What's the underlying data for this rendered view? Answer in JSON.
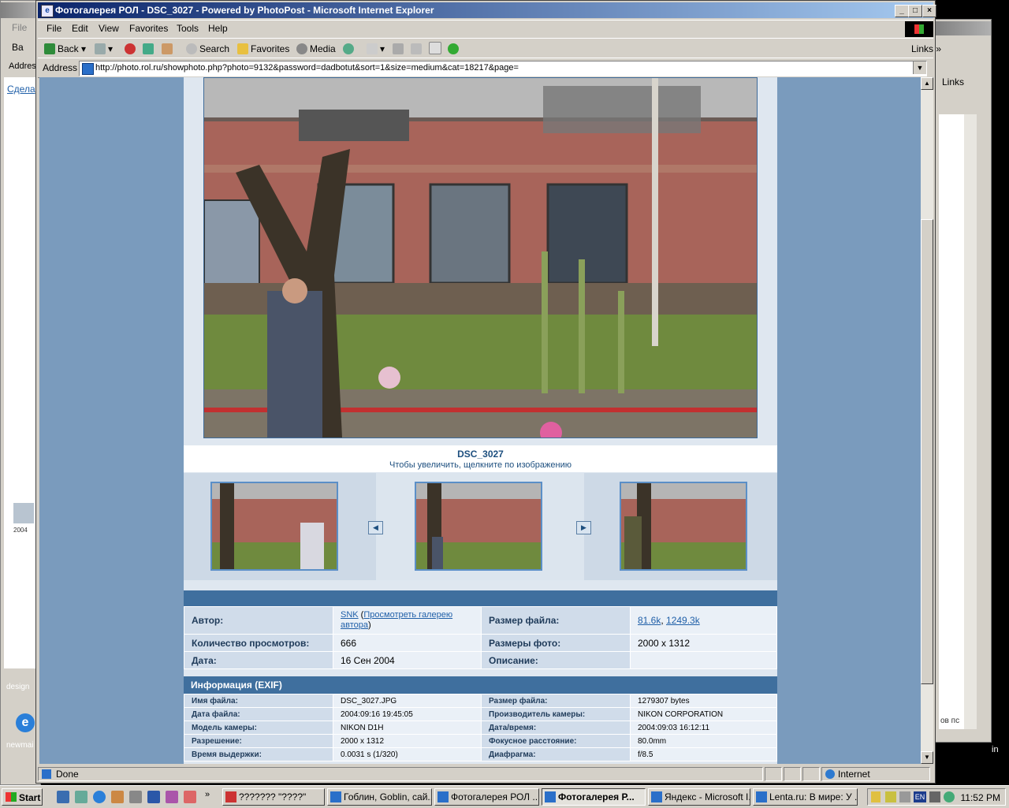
{
  "window": {
    "title": "Фотогалерея РОЛ - DSC_3027 - Powered by PhotoPost - Microsoft Internet Explorer"
  },
  "menu": [
    "File",
    "Edit",
    "View",
    "Favorites",
    "Tools",
    "Help"
  ],
  "toolbar": {
    "back": "Back",
    "search": "Search",
    "favorites": "Favorites",
    "media": "Media",
    "links": "Links"
  },
  "address": {
    "label": "Address",
    "url": "http://photo.rol.ru/showphoto.php?photo=9132&password=dadbotut&sort=1&size=medium&cat=18217&page="
  },
  "photo": {
    "title": "DSC_3027",
    "hint": "Чтобы увеличить, щелкните по изображению"
  },
  "details": {
    "author_label": "Автор:",
    "author_name": "SNK",
    "author_gallery_open": " (",
    "author_gallery": "Просмотреть галерею автора",
    "author_gallery_close": ")",
    "filesize_label": "Размер файла:",
    "filesize_small": "81.6k",
    "filesize_sep": ", ",
    "filesize_large": "1249.3k",
    "views_label": "Количество просмотров:",
    "views": "666",
    "dimensions_label": "Размеры фото:",
    "dimensions": "2000 x 1312",
    "date_label": "Дата:",
    "date": "16 Сен 2004",
    "description_label": "Описание:",
    "description": ""
  },
  "exif": {
    "header": "Информация (EXIF)",
    "rows": [
      [
        "Имя файла:",
        "DSC_3027.JPG",
        "Размер файла:",
        "1279307 bytes"
      ],
      [
        "Дата файла:",
        "2004:09:16 19:45:05",
        "Производитель камеры:",
        "NIKON CORPORATION"
      ],
      [
        "Модель камеры:",
        "NIKON D1H",
        "Дата/время:",
        "2004:09:03 16:12:11"
      ],
      [
        "Разрешение:",
        "2000 x 1312",
        "Фокусное расстояние:",
        "80.0mm"
      ],
      [
        "Время выдержки:",
        "0.0031 s (1/320)",
        "Диафрагма:",
        "f/8.5"
      ]
    ]
  },
  "status": {
    "text": "Done",
    "zone": "Internet"
  },
  "taskbar": {
    "start": "Start",
    "tasks": [
      "??????? \"????\"",
      "Гоблин, Goblin, сай...",
      "Фотогалерея РОЛ ...",
      "Фотогалерея Р...",
      "Яндекс - Microsoft I...",
      "Lenta.ru: В мире: У ..."
    ],
    "lang": "EN",
    "clock": "11:52 PM"
  },
  "background": {
    "left_file": "File",
    "left_back": "Ba",
    "left_address": "Addres",
    "left_link": "Сдела",
    "left_year": "2004",
    "desktop_label1": "design",
    "desktop_label2": "newmai",
    "right_links": "Links",
    "right_text": "ов пс",
    "right_in": "in"
  },
  "colors": {
    "title_gradient_start": "#0a246a",
    "page_bg": "#7a9bbd",
    "header_blue": "#3f6f9e",
    "link": "#1f5fa8"
  }
}
